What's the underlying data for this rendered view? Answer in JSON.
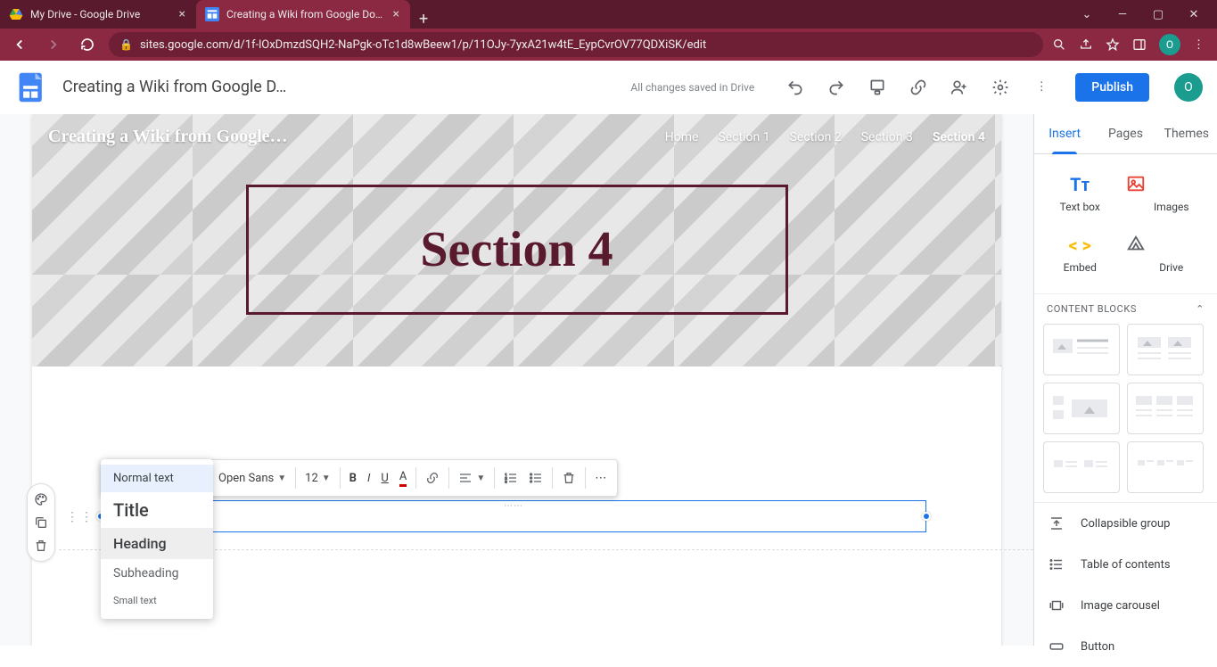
{
  "browser": {
    "tabs": [
      {
        "title": "My Drive - Google Drive"
      },
      {
        "title": "Creating a Wiki from Google Doc..."
      }
    ],
    "url": "sites.google.com/d/1f-lOxDmzdSQH2-NaPgk-oTc1d8wBeew1/p/11OJy-7yxA21w4tE_EypCvrOV77QDXiSK/edit",
    "avatar": "O"
  },
  "app": {
    "docTitle": "Creating a Wiki from Google D…",
    "saveStatus": "All changes saved in Drive",
    "publish": "Publish",
    "avatar": "O"
  },
  "rightPanel": {
    "tabs": {
      "insert": "Insert",
      "pages": "Pages",
      "themes": "Themes"
    },
    "insert": {
      "textbox": "Text box",
      "images": "Images",
      "embed": "Embed",
      "drive": "Drive"
    },
    "blocksHeader": "CONTENT BLOCKS",
    "list": {
      "collapsible": "Collapsible group",
      "toc": "Table of contents",
      "carousel": "Image carousel",
      "button": "Button"
    }
  },
  "site": {
    "title": "Creating a Wiki from Google…",
    "menu": [
      "Home",
      "Section 1",
      "Section 2",
      "Section 3",
      "Section 4"
    ],
    "heroTitle": "Section 4"
  },
  "textToolbar": {
    "styleSelected": "Normal text",
    "font": "Open Sans",
    "size": "12",
    "styleOptions": {
      "normal": "Normal text",
      "title": "Title",
      "heading": "Heading",
      "subheading": "Subheading",
      "small": "Small text"
    }
  }
}
